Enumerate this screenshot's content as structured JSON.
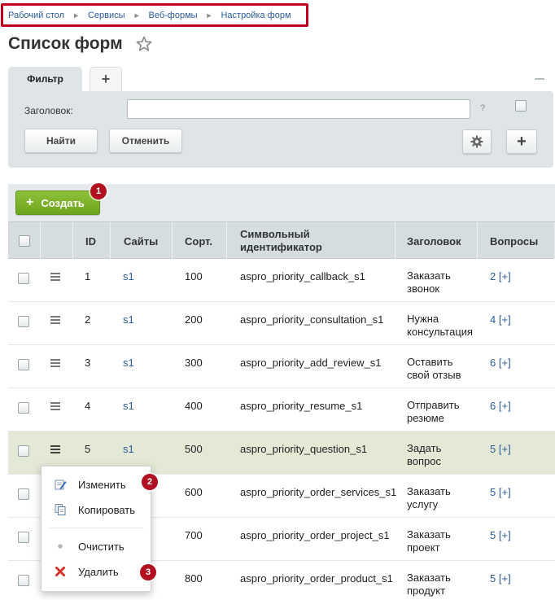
{
  "breadcrumb": [
    "Рабочий стол",
    "Сервисы",
    "Веб-формы",
    "Настройка форм"
  ],
  "page_title": "Список форм",
  "filter": {
    "tab_label": "Фильтр",
    "add_tab": "+",
    "field_label": "Заголовок:",
    "field_value": "",
    "help": "?",
    "find_button": "Найти",
    "cancel_button": "Отменить",
    "add_button": "+"
  },
  "toolbar": {
    "create_button": "Создать",
    "badge": "1"
  },
  "table": {
    "headers": {
      "id": "ID",
      "sites": "Сайты",
      "sort": "Сорт.",
      "code_line1": "Символьный",
      "code_line2": "идентификатор",
      "title": "Заголовок",
      "questions": "Вопросы"
    },
    "rows": [
      {
        "id": "1",
        "site": "s1",
        "sort": "100",
        "code": "aspro_priority_callback_s1",
        "title1": "Заказать",
        "title2": "звонок",
        "q": "2",
        "add": "[+]"
      },
      {
        "id": "2",
        "site": "s1",
        "sort": "200",
        "code": "aspro_priority_consultation_s1",
        "title1": "Нужна",
        "title2": "консультация",
        "q": "4",
        "add": "[+]"
      },
      {
        "id": "3",
        "site": "s1",
        "sort": "300",
        "code": "aspro_priority_add_review_s1",
        "title1": "Оставить",
        "title2": "свой отзыв",
        "q": "6",
        "add": "[+]"
      },
      {
        "id": "4",
        "site": "s1",
        "sort": "400",
        "code": "aspro_priority_resume_s1",
        "title1": "Отправить",
        "title2": "резюме",
        "q": "6",
        "add": "[+]"
      },
      {
        "id": "5",
        "site": "s1",
        "sort": "500",
        "code": "aspro_priority_question_s1",
        "title1": "Задать",
        "title2": "вопрос",
        "q": "5",
        "add": "[+]"
      },
      {
        "id": "",
        "site": "",
        "sort": "600",
        "code": "aspro_priority_order_services_s1",
        "title1": "Заказать",
        "title2": "услугу",
        "q": "5",
        "add": "[+]"
      },
      {
        "id": "",
        "site": "",
        "sort": "700",
        "code": "aspro_priority_order_project_s1",
        "title1": "Заказать",
        "title2": "проект",
        "q": "5",
        "add": "[+]"
      },
      {
        "id": "",
        "site": "",
        "sort": "800",
        "code": "aspro_priority_order_product_s1",
        "title1": "Заказать",
        "title2": "продукт",
        "q": "5",
        "add": "[+]"
      }
    ]
  },
  "context_menu": {
    "edit": "Изменить",
    "copy": "Копировать",
    "clear": "Очистить",
    "delete": "Удалить",
    "badge_edit": "2",
    "badge_delete": "3"
  },
  "colors": {
    "accent_green": "#7ab22a",
    "badge_red": "#b01020",
    "link": "#2a5b9c",
    "highlight_row": "#e4e9d6"
  }
}
